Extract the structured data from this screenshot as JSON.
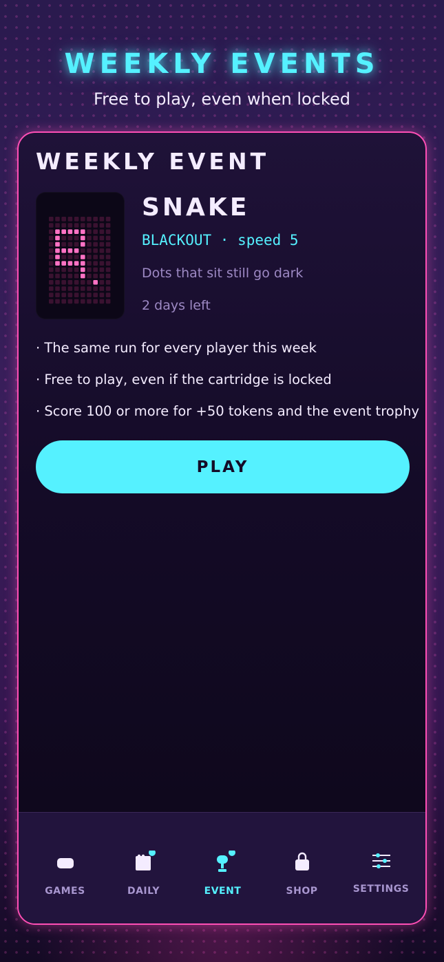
{
  "header": {
    "title": "WEEKLY EVENTS",
    "subtitle": "Free to play, even when locked"
  },
  "event_card": {
    "section_title": "WEEKLY EVENT",
    "game": {
      "name": "SNAKE",
      "mode": "BLACKOUT · speed 5",
      "description": "Dots that sit still go dark",
      "time_left": "2 days left",
      "thumbnail_icon": "snake-pixel-grid-icon"
    },
    "rules": [
      "· The same run for every player this week",
      "· Free to play, even if the cartridge is locked",
      "· Score 100 or more for +50 tokens and the event trophy"
    ],
    "play_label": "PLAY"
  },
  "nav": {
    "active": "event",
    "items": [
      {
        "id": "games",
        "label": "GAMES",
        "icon": "gamepad-icon",
        "badge": false
      },
      {
        "id": "daily",
        "label": "DAILY",
        "icon": "calendar-icon",
        "badge": true
      },
      {
        "id": "event",
        "label": "EVENT",
        "icon": "trophy-icon",
        "badge": true
      },
      {
        "id": "shop",
        "label": "SHOP",
        "icon": "shopping-bag-icon",
        "badge": false
      },
      {
        "id": "settings",
        "label": "SETTINGS",
        "icon": "sliders-icon",
        "badge": false
      }
    ]
  },
  "colors": {
    "accent_cyan": "#55f1ff",
    "accent_pink": "#ff4fb6",
    "background": "#1a0f2e",
    "text": "#f4ecff",
    "muted_text": "#9d89c4"
  }
}
